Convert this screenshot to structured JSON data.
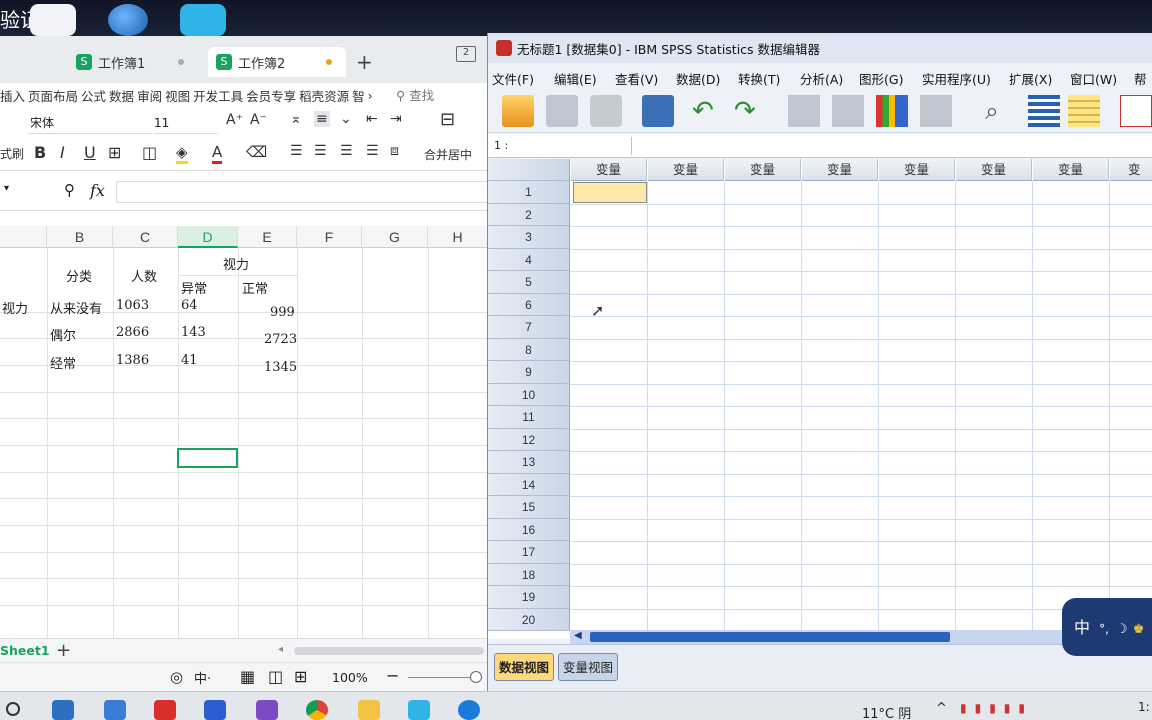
{
  "desktop": {
    "label": "验证"
  },
  "wps": {
    "tabs": [
      {
        "label": "工作簿1"
      },
      {
        "label": "工作簿2"
      }
    ],
    "add_tab": "+",
    "window_count": "2",
    "menu": [
      "插入",
      "页面布局",
      "公式",
      "数据",
      "审阅",
      "视图",
      "开发工具",
      "会员专享",
      "稻壳资源",
      "智"
    ],
    "menu_more": "›",
    "search_label": "查找",
    "font_name": "宋体",
    "font_size": "11",
    "format_brush": "式刷",
    "merge_center": "合并居中",
    "fx_label": "fx",
    "columns": [
      "B",
      "C",
      "D",
      "E",
      "F",
      "G",
      "H"
    ],
    "table": {
      "header_fenlei": "分类",
      "header_renshu": "人数",
      "header_shili": "视力",
      "header_yichang": "异常",
      "header_zhengchang": "正常",
      "row_label_partial": "视力",
      "rows": [
        {
          "category": "从来没有",
          "count": "1063",
          "abnormal": "64",
          "normal": "999"
        },
        {
          "category": "偶尔",
          "count": "2866",
          "abnormal": "143",
          "normal": "2723"
        },
        {
          "category": "经常",
          "count": "1386",
          "abnormal": "41",
          "normal": "1345"
        }
      ]
    },
    "sheet_tab": "Sheet1",
    "zoom": "100%"
  },
  "spss": {
    "title": "无标题1 [数据集0] - IBM SPSS Statistics 数据编辑器",
    "menu": [
      "文件(F)",
      "编辑(E)",
      "查看(V)",
      "数据(D)",
      "转换(T)",
      "分析(A)",
      "图形(G)",
      "实用程序(U)",
      "扩展(X)",
      "窗口(W)",
      "帮助"
    ],
    "cell_ref": "1 :",
    "var_header": "变量",
    "var_header_partial": "变",
    "rows": [
      "1",
      "2",
      "3",
      "4",
      "5",
      "6",
      "7",
      "8",
      "9",
      "10",
      "11",
      "12",
      "13",
      "14",
      "15",
      "16",
      "17",
      "18",
      "19",
      "20"
    ],
    "view_tabs": [
      "数据视图",
      "变量视图"
    ]
  },
  "ime": {
    "label": "中"
  },
  "taskbar": {
    "weather": "11°C 阴",
    "time": "1:"
  },
  "colors": {
    "wps_green": "#1aa260",
    "spss_active_cell": "#fde9a9",
    "tab_dot_gray": "#aaaaaa",
    "tab_dot_orange": "#e8a317"
  }
}
